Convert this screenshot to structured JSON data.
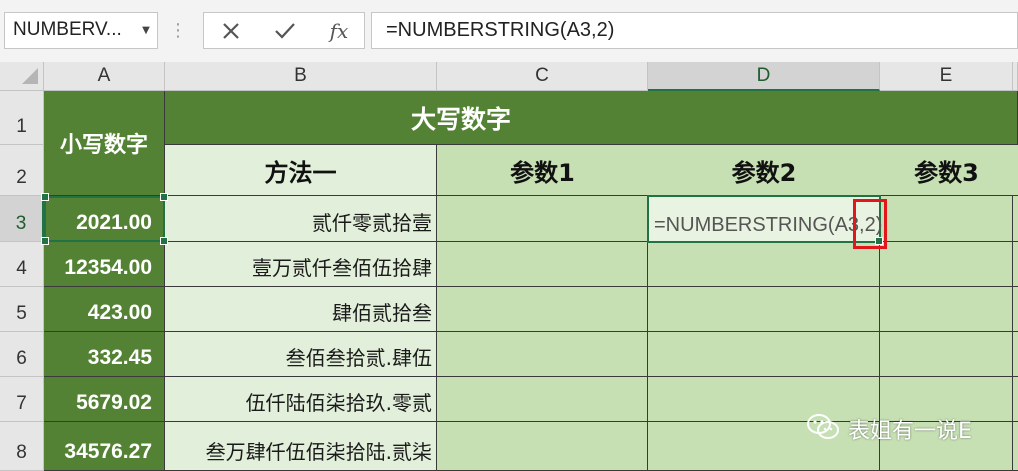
{
  "formula_bar": {
    "name_box": "NUMBERV...",
    "formula": "=NUMBERSTRING(A3,2)",
    "fx_label": "fx"
  },
  "columns": [
    "A",
    "B",
    "C",
    "D",
    "E"
  ],
  "rows": [
    "1",
    "2",
    "3",
    "4",
    "5",
    "6",
    "7",
    "8"
  ],
  "sheet": {
    "a_header": "小写数字",
    "merged_header": "大写数字",
    "b_header": "方法一",
    "c_header": "参数1",
    "d_header": "参数2",
    "e_header": "参数3",
    "a_values": [
      "2021.00",
      "12354.00",
      "423.00",
      "332.45",
      "5679.02",
      "34576.27"
    ],
    "b_values": [
      "贰仟零贰拾壹",
      "壹万贰仟叁佰伍拾肆",
      "肆佰贰拾叁",
      "叁佰叁拾贰.肆伍",
      "伍仟陆佰柒拾玖.零贰",
      "叁万肆仟伍佰柒拾陆.贰柒"
    ],
    "editing_cell_text": "=NUMBERSTRING(A3,2)"
  },
  "watermark": "表姐有一说E",
  "colors": {
    "dark_green": "#548235",
    "light_green": "#e2efda",
    "mid_green": "#c6e0b4",
    "selection": "#217346",
    "highlight_box": "#e3161c"
  }
}
